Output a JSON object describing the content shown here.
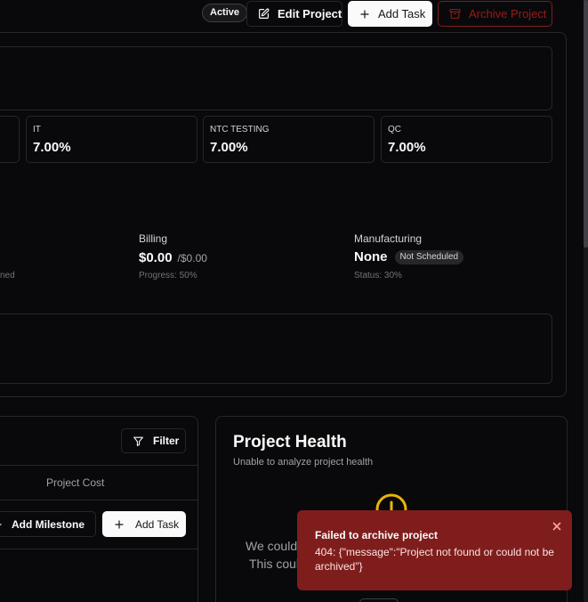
{
  "header": {
    "status_badge": "Active",
    "edit_label": "Edit Project",
    "add_task_label": "Add Task",
    "archive_label": "Archive Project"
  },
  "departments": [
    {
      "name": "IT",
      "value": "7.00%"
    },
    {
      "name": "NTC TESTING",
      "value": "7.00%"
    },
    {
      "name": "QC",
      "value": "7.00%"
    }
  ],
  "partial": {
    "cut_value": "",
    "cut_sub": "ned"
  },
  "billing": {
    "label": "Billing",
    "amount": "$0.00",
    "total": "/$0.00",
    "progress_text": "Progress: 50%"
  },
  "manufacturing": {
    "label": "Manufacturing",
    "value": "None",
    "badge": "Not Scheduled",
    "status_text": "Status: 30%"
  },
  "tasks_card": {
    "filter_label": "Filter",
    "column_project_cost": "Project Cost",
    "add_milestone_label": "Add Milestone",
    "add_task_label": "Add Task"
  },
  "health": {
    "title": "Project Health",
    "subtitle": "Unable to analyze project health",
    "line1": "We couldn",
    "line2": "This coul"
  },
  "toast": {
    "title": "Failed to archive project",
    "message": "404: {\"message\":\"Project not found or could not be archived\"}"
  },
  "colors": {
    "background": "#09090b",
    "border": "#27272a",
    "toast_bg": "#7f1d1d",
    "health_icon": "#eab308",
    "danger_text": "#991b1b"
  },
  "icons": [
    "edit-icon",
    "plus-icon",
    "archive-icon",
    "filter-icon",
    "warning-icon",
    "close-icon"
  ]
}
